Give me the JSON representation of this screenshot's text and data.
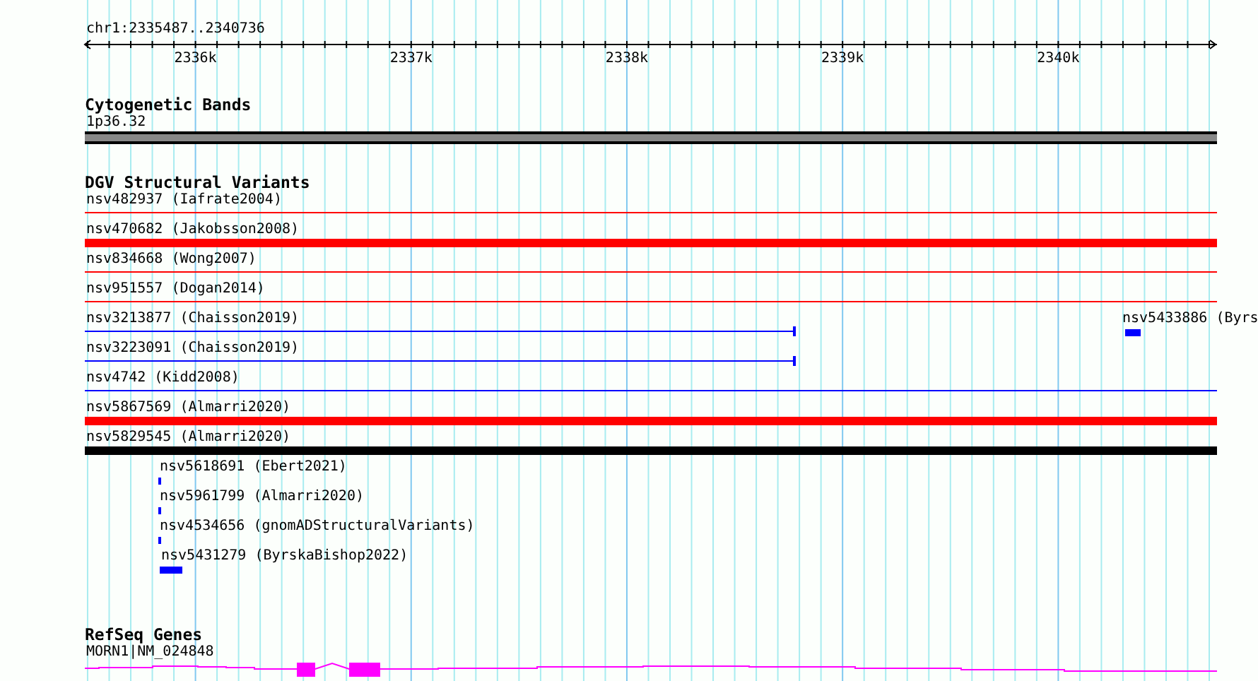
{
  "ruler": {
    "position": "chr1:2335487..2340736",
    "ticks": [
      "2336k",
      "2337k",
      "2338k",
      "2339k",
      "2340k"
    ]
  },
  "cytogenetic_bands": {
    "title": "Cytogenetic Bands",
    "band": "1p36.32"
  },
  "dgv": {
    "title": "DGV Structural Variants",
    "features": [
      {
        "label": "nsv482937 (Iafrate2004)",
        "kind": "line",
        "color": "#ff0000"
      },
      {
        "label": "nsv470682 (Jakobsson2008)",
        "kind": "bar",
        "color": "#ff0000"
      },
      {
        "label": "nsv834668 (Wong2007)",
        "kind": "line",
        "color": "#ff0000"
      },
      {
        "label": "nsv951557 (Dogan2014)",
        "kind": "line",
        "color": "#ff0000"
      },
      {
        "label": "nsv3213877 (Chaisson2019)",
        "kind": "line",
        "color": "#0000ff"
      },
      {
        "label": "nsv5433886 (Byrs",
        "kind": "block",
        "color": "#0000ff"
      },
      {
        "label": "nsv3223091 (Chaisson2019)",
        "kind": "line",
        "color": "#0000ff"
      },
      {
        "label": "nsv4742 (Kidd2008)",
        "kind": "line",
        "color": "#0000ff"
      },
      {
        "label": "nsv5867569 (Almarri2020)",
        "kind": "bar",
        "color": "#ff0000"
      },
      {
        "label": "nsv5829545 (Almarri2020)",
        "kind": "bar",
        "color": "#000000"
      },
      {
        "label": "nsv5618691 (Ebert2021)",
        "kind": "block",
        "color": "#0000ff"
      },
      {
        "label": "nsv5961799 (Almarri2020)",
        "kind": "block",
        "color": "#0000ff"
      },
      {
        "label": "nsv4534656 (gnomADStructuralVariants)",
        "kind": "block",
        "color": "#0000ff"
      },
      {
        "label": "nsv5431279 (ByrskaBishop2022)",
        "kind": "block",
        "color": "#0000ff"
      }
    ]
  },
  "refseq": {
    "title": "RefSeq Genes",
    "gene": "MORN1|NM_024848"
  }
}
